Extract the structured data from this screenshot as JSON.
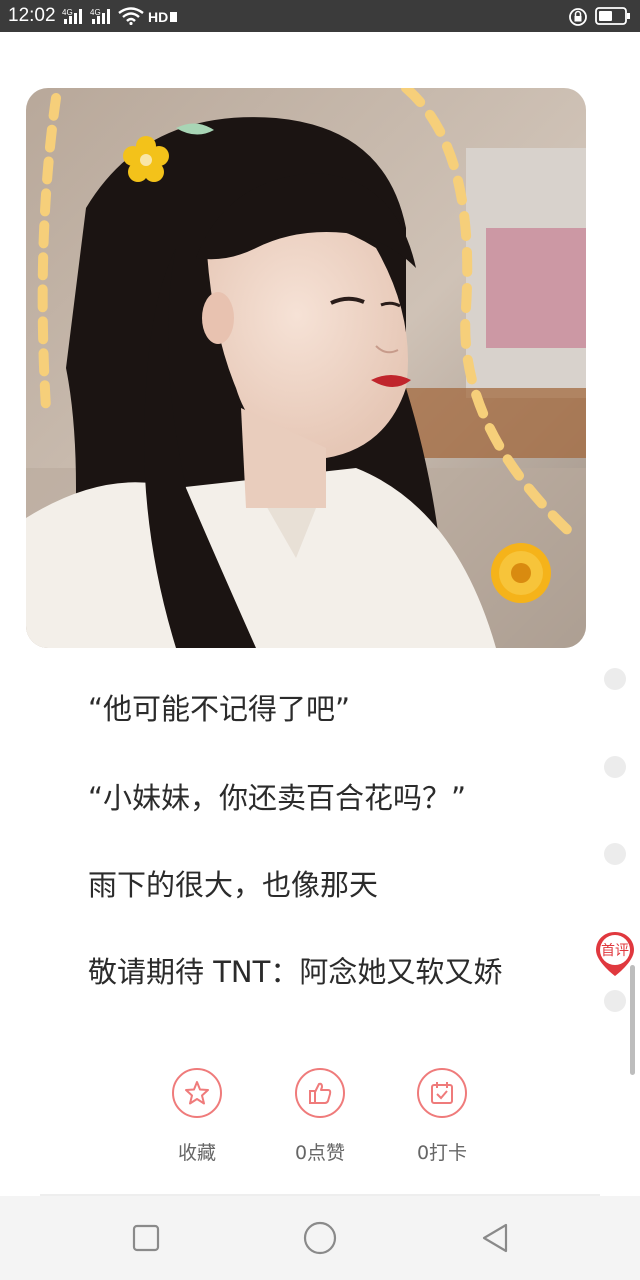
{
  "status_bar": {
    "time": "12:02",
    "network_1": "4G",
    "network_2": "4G",
    "hd_badge": "HD",
    "icons": [
      "signal-icon",
      "signal-icon",
      "wifi-icon",
      "hd-icon",
      "lock-rotation-icon",
      "battery-icon"
    ]
  },
  "article": {
    "image_alt": "girl with yellow flower hair clip",
    "paragraphs": [
      "“他可能不记得了吧”",
      "“小妹妹，你还卖百合花吗？”",
      "雨下的很大，也像那天",
      "敬请期待 TNT：阿念她又软又娇"
    ]
  },
  "side": {
    "first_review_badge": "首评"
  },
  "actions": {
    "favorite_label": "收藏",
    "like_label": "0点赞",
    "checkin_label": "0打卡"
  },
  "colors": {
    "accent": "#ef7b7b",
    "badge_red": "#e0383e",
    "status_bar_bg": "#3b3b3b",
    "nav_bg": "#f4f4f4"
  }
}
